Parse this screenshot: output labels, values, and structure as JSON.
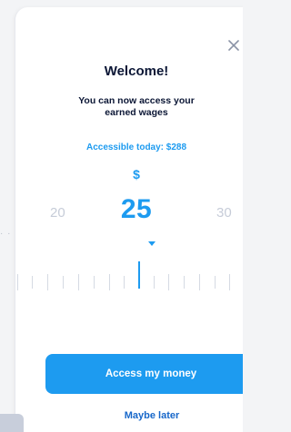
{
  "modal": {
    "close_icon": "close-icon",
    "title": "Welcome!",
    "subtitle_line1": "You can now access your",
    "subtitle_line2": "earned wages",
    "accessible_text": "Accessible today: $288",
    "currency_symbol": "$",
    "selector": {
      "prev_value": "20",
      "current_value": "25",
      "next_value": "30"
    },
    "primary_button_label": "Access my money",
    "secondary_link_label": "Maybe later"
  },
  "colors": {
    "accent": "#1d9bf0",
    "title": "#0b1635",
    "muted": "#c6ccd8",
    "link": "#1767c9"
  },
  "icons": {
    "close": "close-icon",
    "pointer": "caret-down-icon",
    "ruler": "slider-scale-icon"
  }
}
